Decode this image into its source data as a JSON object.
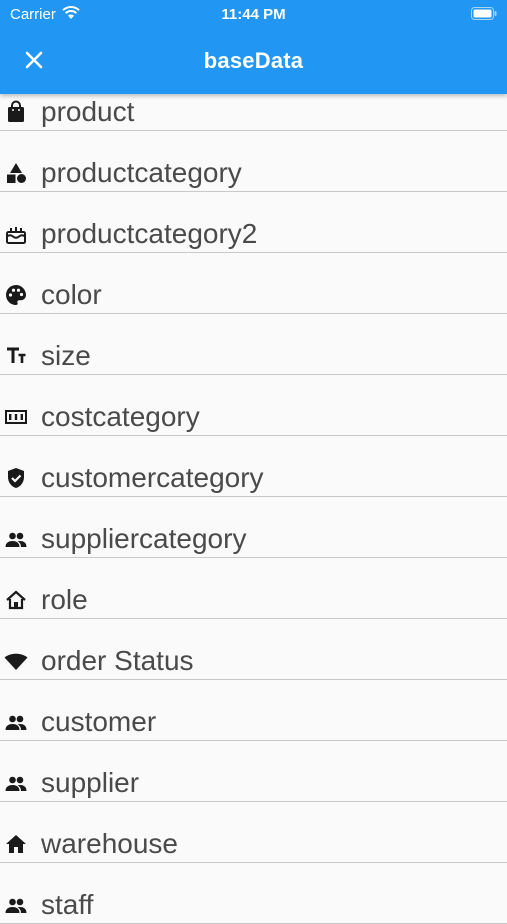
{
  "status_bar": {
    "carrier": "Carrier",
    "time": "11:44 PM"
  },
  "app_bar": {
    "title": "baseData",
    "close_icon": "close-icon",
    "color": "#2196f3"
  },
  "items": [
    {
      "label": "product",
      "icon": "shopping-bag-icon"
    },
    {
      "label": "productcategory",
      "icon": "category-shapes-icon"
    },
    {
      "label": "productcategory2",
      "icon": "cake-icon"
    },
    {
      "label": "color",
      "icon": "palette-icon"
    },
    {
      "label": "size",
      "icon": "text-size-icon"
    },
    {
      "label": "costcategory",
      "icon": "pin-input-icon"
    },
    {
      "label": "customercategory",
      "icon": "verified-shield-icon"
    },
    {
      "label": "suppliercategory",
      "icon": "people-icon"
    },
    {
      "label": "role",
      "icon": "house-outline-icon"
    },
    {
      "label": "order Status",
      "icon": "wifi-icon"
    },
    {
      "label": "customer",
      "icon": "people-icon"
    },
    {
      "label": "supplier",
      "icon": "people-icon"
    },
    {
      "label": "warehouse",
      "icon": "house-icon"
    },
    {
      "label": "staff",
      "icon": "people-icon"
    }
  ]
}
